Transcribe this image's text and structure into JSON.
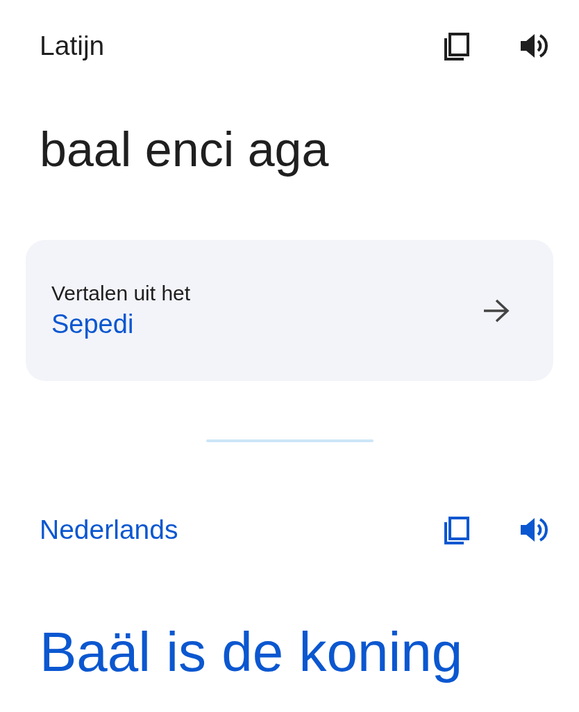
{
  "source": {
    "language": "Latijn",
    "text": "baal enci aga"
  },
  "suggestion": {
    "prompt": "Vertalen uit het",
    "language": "Sepedi"
  },
  "target": {
    "language": "Nederlands",
    "text": "Baäl is de koning"
  }
}
